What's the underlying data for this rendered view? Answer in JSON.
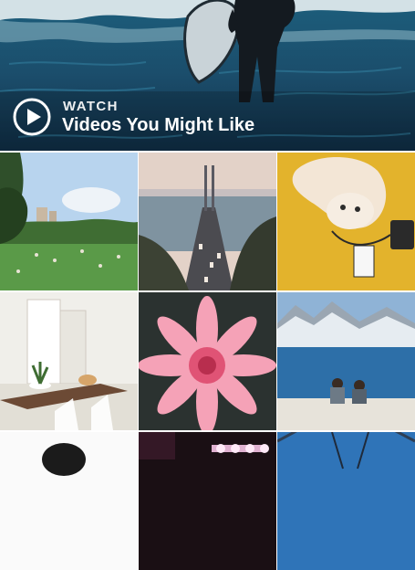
{
  "watch": {
    "kicker": "WATCH",
    "title": "Videos You Might Like"
  },
  "grid": {
    "tiles": [
      {
        "name": "park-photo"
      },
      {
        "name": "bridge-traffic-photo"
      },
      {
        "name": "cat-on-blanket-photo"
      },
      {
        "name": "dining-room-photo"
      },
      {
        "name": "pink-flower-photo"
      },
      {
        "name": "lake-couple-photo"
      },
      {
        "name": "portrait-photo"
      },
      {
        "name": "concert-lights-photo"
      },
      {
        "name": "ferris-wheel-photo"
      }
    ]
  }
}
